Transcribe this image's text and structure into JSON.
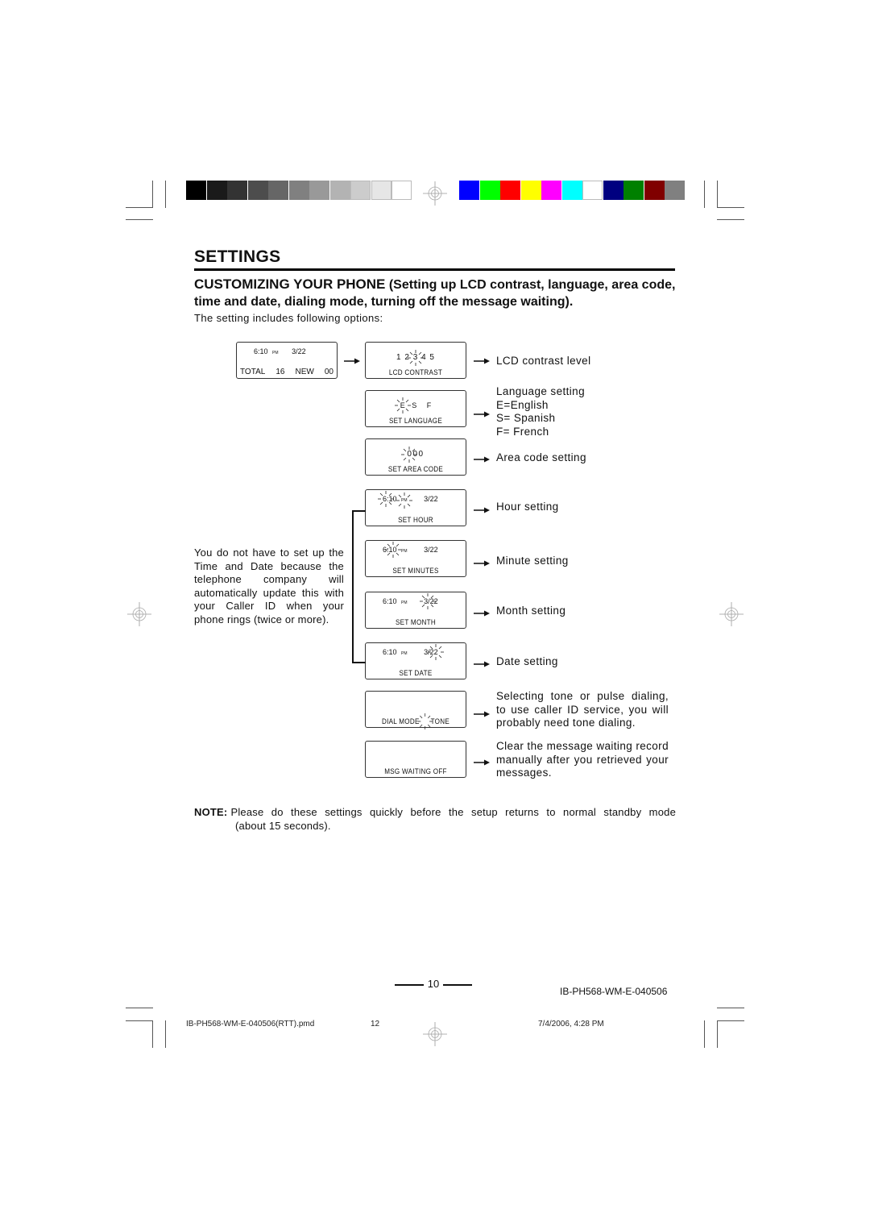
{
  "print_marks": {
    "grayscale_swatches": [
      "#000000",
      "#1a1a1a",
      "#333333",
      "#4d4d4d",
      "#666666",
      "#808080",
      "#999999",
      "#b3b3b3",
      "#cccccc",
      "#e6e6e6",
      "#ffffff"
    ],
    "color_swatches": [
      "#0000ff",
      "#00ff00",
      "#ff0000",
      "#ffff00",
      "#ff00ff",
      "#00ffff",
      "#ffffff",
      "#000080",
      "#008000",
      "#800000",
      "#808080"
    ]
  },
  "header": {
    "title": "SETTINGS",
    "subtitle_main": "CUSTOMIZING YOUR PHONE",
    "subtitle_detail": " (Setting up LCD contrast, language, area code, time and date, dialing mode, turning off the message waiting).",
    "intro": "The setting includes following options:"
  },
  "standby_screen": {
    "time": "6:10",
    "ampm": "PM",
    "date": "3/22",
    "total_label": "TOTAL",
    "total_value": "16",
    "new_label": "NEW",
    "new_value": "00"
  },
  "screens": [
    {
      "id": "lcd-contrast",
      "display": [
        "1",
        "2",
        "3",
        "4",
        "5"
      ],
      "blinking": "3",
      "label": "LCD CONTRAST",
      "description": [
        "LCD contrast level"
      ]
    },
    {
      "id": "language",
      "display": [
        "E",
        "S",
        "F"
      ],
      "blinking": "E",
      "label": "SET LANGUAGE",
      "description": [
        "Language setting",
        "E=English",
        "S= Spanish",
        "F= French"
      ]
    },
    {
      "id": "area-code",
      "display": "000",
      "label": "SET AREA CODE",
      "description": [
        "Area code setting"
      ]
    },
    {
      "id": "hour",
      "time": "6:10",
      "ampm": "PM",
      "date": "3/22",
      "label": "SET HOUR",
      "description": [
        "Hour setting"
      ]
    },
    {
      "id": "minutes",
      "time": "6:10",
      "ampm": "PM",
      "date": "3/22",
      "label": "SET MINUTES",
      "description": [
        "Minute setting"
      ]
    },
    {
      "id": "month",
      "time": "6:10",
      "ampm": "PM",
      "date": "3/22",
      "label": "SET MONTH",
      "description": [
        "Month setting"
      ]
    },
    {
      "id": "date",
      "time": "6:10",
      "ampm": "PM",
      "date": "3/22",
      "label": "SET DATE",
      "description": [
        "Date setting"
      ]
    },
    {
      "id": "dial-mode",
      "label_left": "DIAL MODE",
      "label_right": "TONE",
      "description": [
        "Selecting tone or pulse dialing,",
        "to use caller ID service, you will",
        "probably need tone dialing."
      ]
    },
    {
      "id": "msg-waiting",
      "label": "MSG WAITING OFF",
      "description": [
        "Clear the message waiting record",
        "manually after you retrieved your",
        "messages."
      ]
    }
  ],
  "side_note": "You do not have to set up the Time and Date because the telephone company will automatically update this with your Caller ID when your phone rings (twice or more).",
  "note": {
    "label": "NOTE:",
    "line1": "Please do these settings quickly before the setup returns to normal standby mode",
    "line2": "(about 15 seconds)."
  },
  "footer": {
    "page_number": "10",
    "doc_id": "IB-PH568-WM-E-040506",
    "file_name": "IB-PH568-WM-E-040506(RTT).pmd",
    "file_page": "12",
    "timestamp": "7/4/2006, 4:28 PM"
  }
}
